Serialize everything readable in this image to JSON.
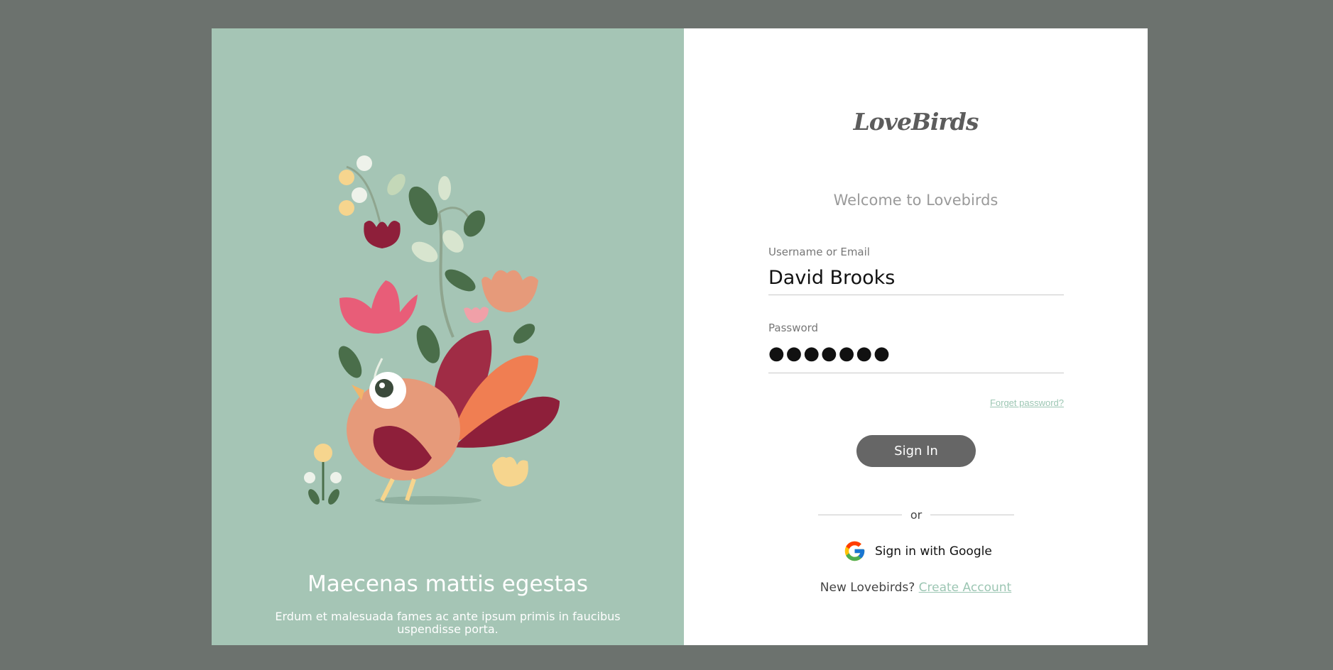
{
  "left_panel": {
    "title": "Maecenas mattis egestas",
    "subtitle": "Erdum et malesuada fames ac ante ipsum primis in faucibus uspendisse porta.",
    "illustration_icon": "bird-with-flowers-illustration"
  },
  "brand": {
    "logo": "LoveBirds"
  },
  "form": {
    "welcome": "Welcome to Lovebirds",
    "username_label": "Username or Email",
    "username_value": "David Brooks",
    "password_label": "Password",
    "password_value": "●●●●●●●",
    "forgot_label": "Forget password?",
    "signin_label": "Sign In",
    "or_label": "or",
    "google_label": "Sign in with Google",
    "google_icon": "google-g-icon",
    "new_text": "New Lovebirds?",
    "create_label": "Create Account"
  },
  "colors": {
    "page_bg": "#6c726e",
    "left_bg": "#a5c5b5",
    "accent": "#9cc6b3",
    "button": "#666666"
  }
}
